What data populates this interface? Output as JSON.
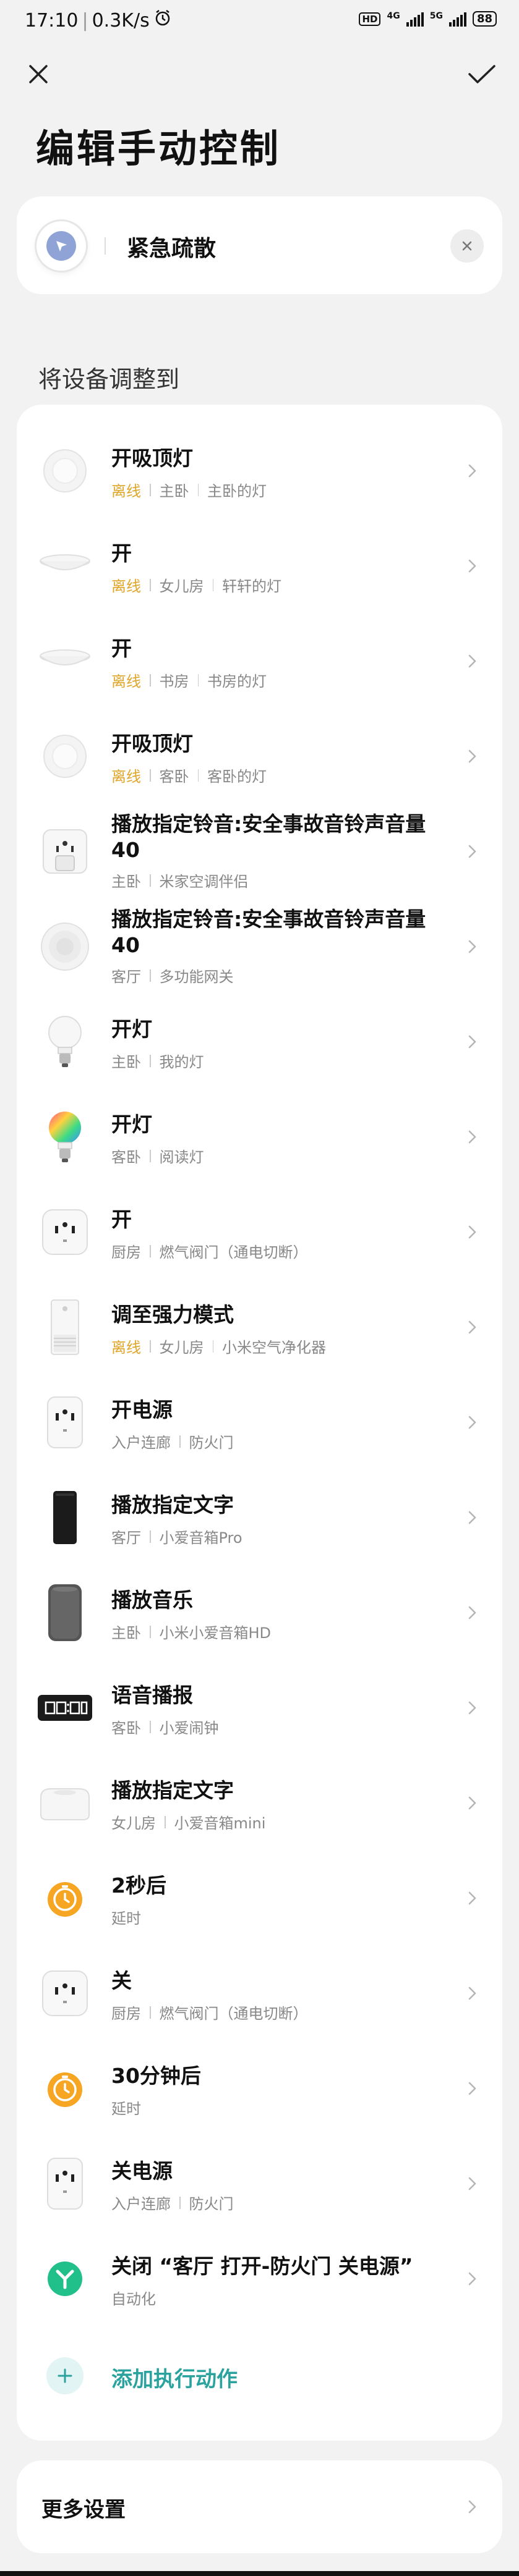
{
  "status_bar": {
    "time": "17:10",
    "speed": "0.3K/s",
    "hd": "HD",
    "net1": "4G",
    "net2": "5G",
    "battery": "88"
  },
  "page": {
    "title": "编辑手动控制"
  },
  "scene": {
    "name": "紧急疏散"
  },
  "section": {
    "label": "将设备调整到"
  },
  "actions": [
    {
      "title": "开吸顶灯",
      "status": "离线",
      "room": "主卧",
      "device": "主卧的灯",
      "icon": "ceiling-light-icon"
    },
    {
      "title": "开",
      "status": "离线",
      "room": "女儿房",
      "device": "轩轩的灯",
      "icon": "pendant-light-icon"
    },
    {
      "title": "开",
      "status": "离线",
      "room": "书房",
      "device": "书房的灯",
      "icon": "pendant-light-icon"
    },
    {
      "title": "开吸顶灯",
      "status": "离线",
      "room": "客卧",
      "device": "客卧的灯",
      "icon": "ceiling-light-icon"
    },
    {
      "title": "播放指定铃音:安全事故音铃声音量40",
      "status": "",
      "room": "主卧",
      "device": "米家空调伴侣",
      "icon": "ac-companion-icon"
    },
    {
      "title": "播放指定铃音:安全事故音铃声音量40",
      "status": "",
      "room": "客厅",
      "device": "多功能网关",
      "icon": "gateway-icon"
    },
    {
      "title": "开灯",
      "status": "",
      "room": "主卧",
      "device": "我的灯",
      "icon": "bulb-icon"
    },
    {
      "title": "开灯",
      "status": "",
      "room": "客卧",
      "device": "阅读灯",
      "icon": "color-bulb-icon"
    },
    {
      "title": "开",
      "status": "",
      "room": "厨房",
      "device": "燃气阀门（通电切断）",
      "icon": "smart-plug-icon"
    },
    {
      "title": "调至强力模式",
      "status": "离线",
      "room": "女儿房",
      "device": "小米空气净化器",
      "icon": "air-purifier-icon"
    },
    {
      "title": "开电源",
      "status": "",
      "room": "入户连廊",
      "device": "防火门",
      "icon": "smart-plug-icon"
    },
    {
      "title": "播放指定文字",
      "status": "",
      "room": "客厅",
      "device": "小爱音箱Pro",
      "icon": "speaker-pro-icon"
    },
    {
      "title": "播放音乐",
      "status": "",
      "room": "主卧",
      "device": "小米小爱音箱HD",
      "icon": "speaker-hd-icon"
    },
    {
      "title": "语音播报",
      "status": "",
      "room": "客卧",
      "device": "小爱闹钟",
      "icon": "alarm-clock-icon"
    },
    {
      "title": "播放指定文字",
      "status": "",
      "room": "女儿房",
      "device": "小爱音箱mini",
      "icon": "speaker-mini-icon"
    },
    {
      "title": "2秒后",
      "status": "",
      "room": "延时",
      "device": "",
      "icon": "timer-icon"
    },
    {
      "title": "关",
      "status": "",
      "room": "厨房",
      "device": "燃气阀门（通电切断）",
      "icon": "smart-plug-icon"
    },
    {
      "title": "30分钟后",
      "status": "",
      "room": "延时",
      "device": "",
      "icon": "timer-icon"
    },
    {
      "title": "关电源",
      "status": "",
      "room": "入户连廊",
      "device": "防火门",
      "icon": "smart-plug-icon"
    },
    {
      "title": "关闭 “客厅 打开-防火门 关电源”",
      "status": "",
      "room": "自动化",
      "device": "",
      "icon": "automation-icon"
    }
  ],
  "add_action": {
    "label": "添加执行动作"
  },
  "more_settings": {
    "label": "更多设置"
  },
  "colors": {
    "offline": "#e0a62a",
    "accent": "#2aa39e",
    "timer": "#f6a623",
    "automation": "#21c08b"
  }
}
